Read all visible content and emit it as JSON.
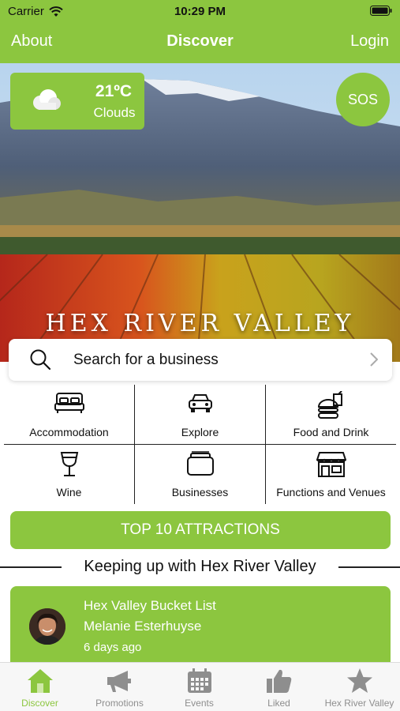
{
  "status_bar": {
    "carrier": "Carrier",
    "time": "10:29 PM"
  },
  "nav": {
    "left": "About",
    "title": "Discover",
    "right": "Login"
  },
  "hero": {
    "title": "HEX RIVER VALLEY"
  },
  "weather": {
    "temperature": "21ºC",
    "condition": "Clouds",
    "icon": "cloud-icon"
  },
  "sos": {
    "label": "SOS"
  },
  "search": {
    "placeholder": "Search for a business"
  },
  "categories": [
    {
      "label": "Accommodation",
      "icon": "bed-icon"
    },
    {
      "label": "Explore",
      "icon": "car-icon"
    },
    {
      "label": "Food and Drink",
      "icon": "burger-icon"
    },
    {
      "label": "Wine",
      "icon": "wine-glass-icon"
    },
    {
      "label": "Businesses",
      "icon": "briefcase-icon"
    },
    {
      "label": "Functions and Venues",
      "icon": "storefront-icon"
    }
  ],
  "top_attractions": {
    "label": "TOP 10 ATTRACTIONS"
  },
  "section": {
    "title": "Keeping up with Hex River Valley"
  },
  "feed": [
    {
      "title": "Hex Valley Bucket List",
      "author": "Melanie Esterhuyse",
      "time": "6 days ago"
    }
  ],
  "tabs": [
    {
      "label": "Discover",
      "icon": "home-icon",
      "active": true
    },
    {
      "label": "Promotions",
      "icon": "megaphone-icon",
      "active": false
    },
    {
      "label": "Events",
      "icon": "calendar-icon",
      "active": false
    },
    {
      "label": "Liked",
      "icon": "thumbs-up-icon",
      "active": false
    },
    {
      "label": "Hex River Valley",
      "icon": "star-icon",
      "active": false
    }
  ],
  "colors": {
    "accent": "#8cc63f",
    "tab_inactive": "#8e8e8e"
  }
}
